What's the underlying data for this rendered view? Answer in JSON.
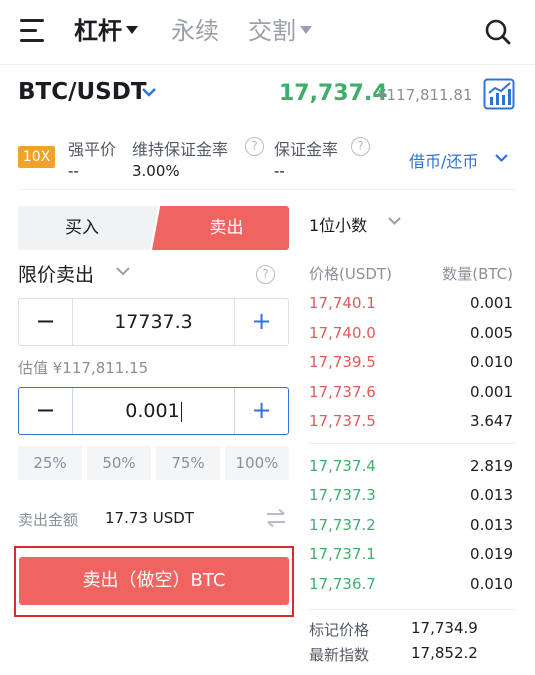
{
  "nav": {
    "tabs": [
      {
        "label": "杠杆",
        "active": true
      },
      {
        "label": "永续",
        "active": false
      },
      {
        "label": "交割",
        "active": false
      }
    ]
  },
  "pair": {
    "symbol": "BTC/USDT",
    "last_price": "17,737.4",
    "cny_price": "¥117,811.81"
  },
  "margin_info": {
    "leverage": "10X",
    "liq_price_label": "强平价",
    "liq_price_value": "--",
    "maint_ratio_label": "维持保证金率",
    "maint_ratio_value": "3.00%",
    "margin_ratio_label": "保证金率",
    "margin_ratio_value": "--",
    "borrow_label": "借币/还币"
  },
  "trade": {
    "buy_tab": "买入",
    "sell_tab": "卖出",
    "order_type": "限价卖出",
    "price_value": "17737.3",
    "estimate": "估值 ¥117,811.15",
    "qty_value": "0.001",
    "percents": [
      "25%",
      "50%",
      "75%",
      "100%"
    ],
    "sell_amount_label": "卖出金额",
    "sell_amount_value": "17.73 USDT",
    "submit_label": "卖出（做空）BTC"
  },
  "orderbook": {
    "precision": "1位小数",
    "price_header": "价格(USDT)",
    "qty_header": "数量(BTC)",
    "asks": [
      {
        "price": "17,740.1",
        "qty": "0.001"
      },
      {
        "price": "17,740.0",
        "qty": "0.005"
      },
      {
        "price": "17,739.5",
        "qty": "0.010"
      },
      {
        "price": "17,737.6",
        "qty": "0.001"
      },
      {
        "price": "17,737.5",
        "qty": "3.647"
      }
    ],
    "bids": [
      {
        "price": "17,737.4",
        "qty": "2.819"
      },
      {
        "price": "17,737.3",
        "qty": "0.013"
      },
      {
        "price": "17,737.2",
        "qty": "0.013"
      },
      {
        "price": "17,737.1",
        "qty": "0.019"
      },
      {
        "price": "17,736.7",
        "qty": "0.010"
      }
    ],
    "mark_price_label": "标记价格",
    "mark_price_value": "17,734.9",
    "index_price_label": "最新指数",
    "index_price_value": "17,852.2"
  },
  "colors": {
    "sell": "#ef6461",
    "buy_green": "#3fae6a",
    "accent_blue": "#2f73d8",
    "leverage_badge": "#f2a22b"
  },
  "icons": [
    "menu-icon",
    "search-icon",
    "chart-icon",
    "help-icon",
    "swap-icon",
    "chevron-down-icon"
  ]
}
